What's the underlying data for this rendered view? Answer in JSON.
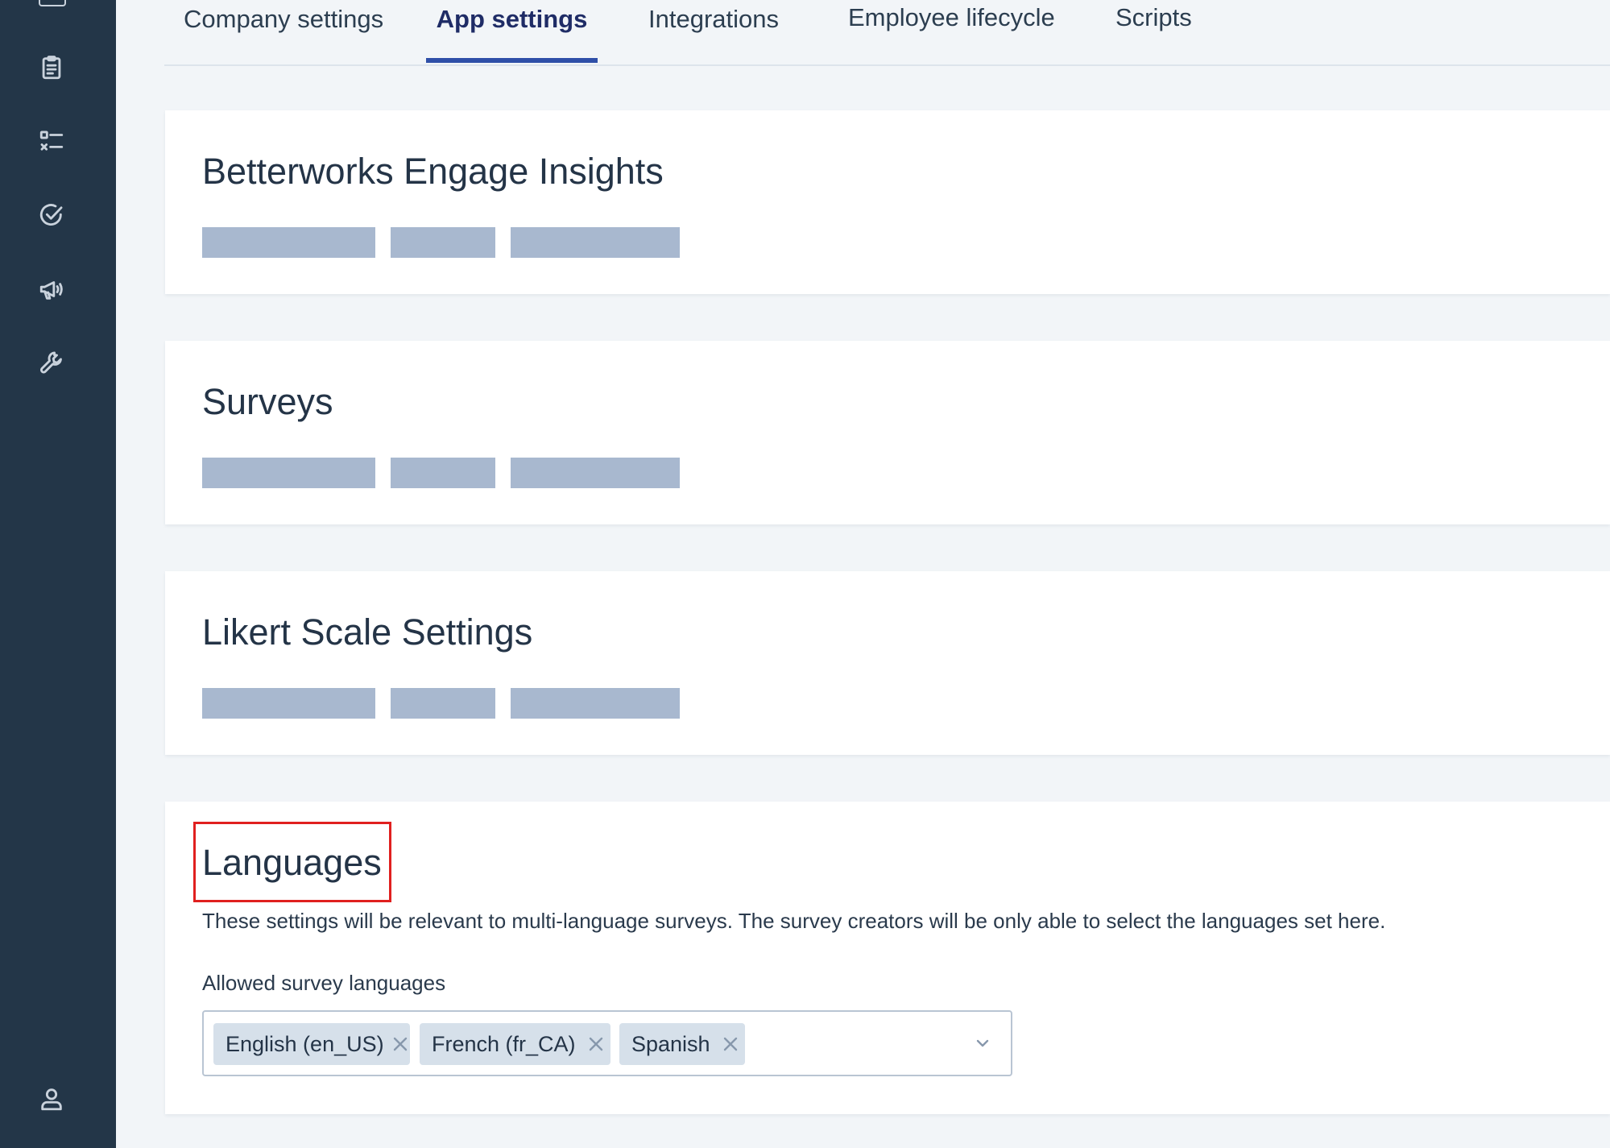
{
  "sidebar": {
    "icons": [
      {
        "name": "clipboard-icon"
      },
      {
        "name": "checklist-icon"
      },
      {
        "name": "check-circle-icon"
      },
      {
        "name": "megaphone-icon"
      },
      {
        "name": "wrench-icon"
      },
      {
        "name": "user-icon"
      }
    ]
  },
  "tabs": [
    {
      "label": "Company settings",
      "active": false
    },
    {
      "label": "App settings",
      "active": true
    },
    {
      "label": "Integrations",
      "active": false
    },
    {
      "label": "Employee lifecycle",
      "active": false
    },
    {
      "label": "Scripts",
      "active": false
    }
  ],
  "sections": {
    "engage_insights": {
      "title": "Betterworks Engage Insights"
    },
    "surveys": {
      "title": "Surveys"
    },
    "likert": {
      "title": "Likert Scale Settings"
    },
    "languages": {
      "title": "Languages",
      "description": "These settings will be relevant to multi-language surveys. The survey creators will be only able to select the languages set here.",
      "field_label": "Allowed survey languages",
      "selected": [
        "English (en_US)",
        "French (fr_CA)",
        "Spanish"
      ]
    }
  },
  "colors": {
    "sidebar_bg": "#233648",
    "tab_active_underline": "#2f4fa8",
    "skeleton": "#a8b8cf",
    "highlight_box": "#e0201f"
  }
}
